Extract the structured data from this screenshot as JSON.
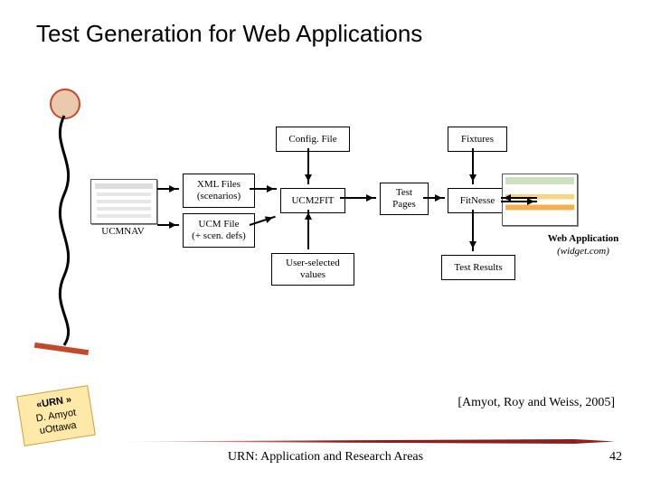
{
  "title": "Test Generation for Web Applications",
  "diagram": {
    "ucmnav_caption": "UCMNAV",
    "xml_files": "XML Files\n(scenarios)",
    "ucm_file": "UCM File\n(+ scen. defs)",
    "config_file": "Config. File",
    "ucm2fit": "UCM2FIT",
    "user_selected": "User-selected\nvalues",
    "test_pages": "Test\nPages",
    "fixtures": "Fixtures",
    "fitnesse": "FitNesse",
    "test_results": "Test Results",
    "web_app_label": "Web Application",
    "web_app_sub": "(widget.com)"
  },
  "citation": "[Amyot, Roy and Weiss, 2005]",
  "sticker": {
    "tag": "«URN »",
    "author": "D. Amyot",
    "affiliation": "uOttawa"
  },
  "footer": {
    "text": "URN: Application and Research Areas",
    "page": "42"
  }
}
